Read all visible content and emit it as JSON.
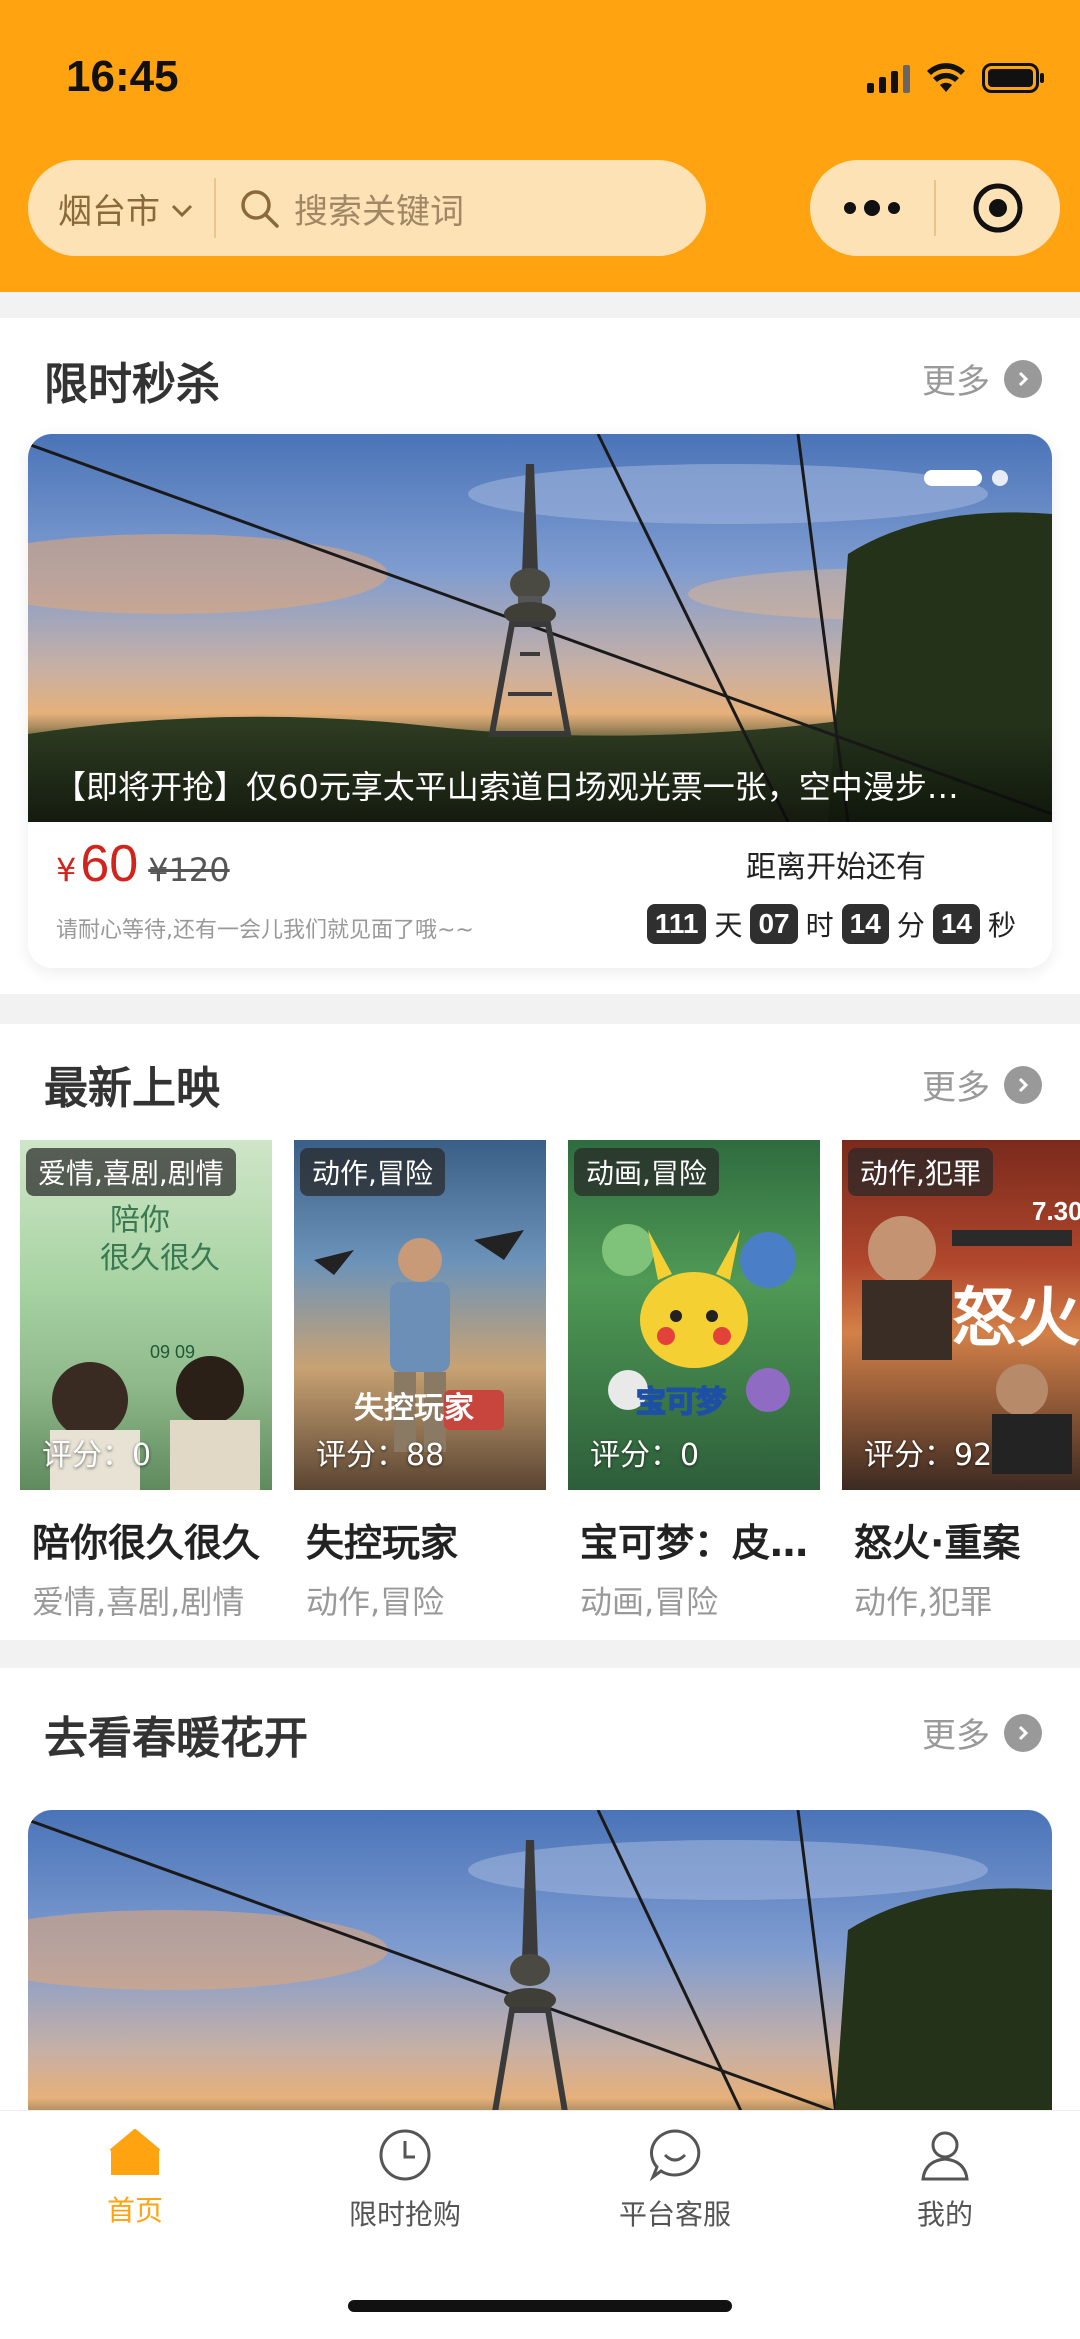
{
  "status_bar": {
    "time": "16:45"
  },
  "header": {
    "city": "烟台市",
    "search_placeholder": "搜索关键词",
    "accent_color": "#ffa310"
  },
  "flash_sale": {
    "title": "限时秒杀",
    "more": "更多",
    "caption": "【即将开抢】仅60元享太平山索道日场观光票一张，空中漫步…",
    "price_symbol": "¥",
    "price_now": "60",
    "price_old": "¥120",
    "note": "请耐心等待,还有一会儿我们就见面了哦~~",
    "countdown_label": "距离开始还有",
    "countdown": {
      "days": "111",
      "days_unit": "天",
      "hours": "07",
      "hours_unit": "时",
      "minutes": "14",
      "minutes_unit": "分",
      "seconds": "14",
      "seconds_unit": "秒"
    }
  },
  "new_release": {
    "title": "最新上映",
    "more": "更多",
    "movies": [
      {
        "tag": "爱情,喜剧,剧情",
        "score": "评分：0",
        "title": "陪你很久很久",
        "genre": "爱情,喜剧,剧情"
      },
      {
        "tag": "动作,冒险",
        "score": "评分：88",
        "title": "失控玩家",
        "genre": "动作,冒险"
      },
      {
        "tag": "动画,冒险",
        "score": "评分：0",
        "title": "宝可梦：皮…",
        "genre": "动画,冒险"
      },
      {
        "tag": "动作,犯罪",
        "score": "评分：92",
        "title": "怒火·重案",
        "genre": "动作,犯罪"
      }
    ]
  },
  "spring": {
    "title": "去看春暖花开",
    "more": "更多"
  },
  "tabbar": {
    "items": [
      {
        "label": "首页",
        "icon": "home-icon",
        "active": true
      },
      {
        "label": "限时抢购",
        "icon": "clock-icon",
        "active": false
      },
      {
        "label": "平台客服",
        "icon": "chat-icon",
        "active": false
      },
      {
        "label": "我的",
        "icon": "user-icon",
        "active": false
      }
    ]
  }
}
